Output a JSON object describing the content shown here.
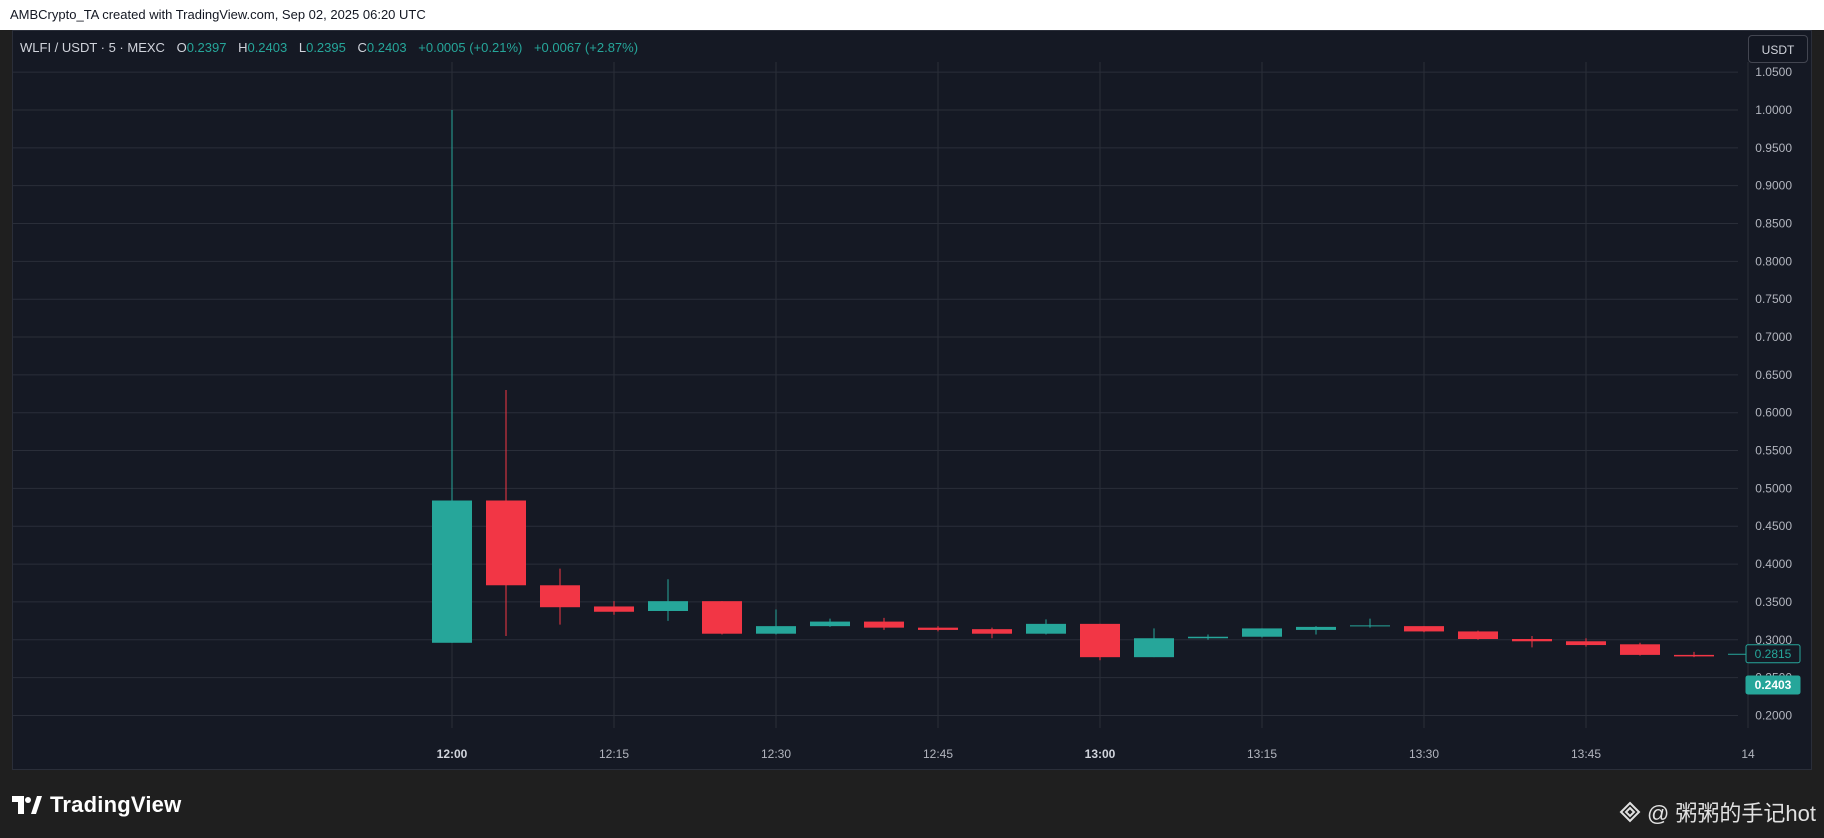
{
  "attribution": "AMBCrypto_TA created with TradingView.com, Sep 02, 2025 06:20 UTC",
  "legend": {
    "symbol": "WLFI / USDT · 5 · MEXC",
    "o_label": "O",
    "o_value": "0.2397",
    "h_label": "H",
    "h_value": "0.2403",
    "l_label": "L",
    "l_value": "0.2395",
    "c_label": "C",
    "c_value": "0.2403",
    "change": "+0.0005 (+0.21%)",
    "change_long": "+0.0067 (+2.87%)"
  },
  "currency_button": "USDT",
  "brand": {
    "name": "TradingView"
  },
  "watermark": {
    "text": "@ 粥粥的手记hot"
  },
  "colors": {
    "up": "#26a69a",
    "down": "#f23645",
    "background": "#151924",
    "grid": "#2a2e39"
  },
  "chart_data": {
    "type": "candlestick",
    "x_tick_labels": [
      "12:00",
      "12:15",
      "12:30",
      "12:45",
      "13:00",
      "13:15",
      "13:30",
      "13:45",
      "14"
    ],
    "y_tick_labels": [
      "0.2000",
      "0.2500",
      "0.3000",
      "0.3500",
      "0.4000",
      "0.4500",
      "0.5000",
      "0.5500",
      "0.6000",
      "0.6500",
      "0.7000",
      "0.7500",
      "0.8000",
      "0.8500",
      "0.9000",
      "0.9500",
      "1.0000",
      "1.0500"
    ],
    "ylim": [
      0.17,
      1.07
    ],
    "grid": true,
    "price_labels": [
      {
        "text": "0.2815",
        "value": 0.2815,
        "style": "outline"
      },
      {
        "text": "0.2403",
        "value": 0.2403,
        "style": "filled"
      }
    ],
    "candles": [
      {
        "time": "12:00",
        "open": 0.296,
        "high": 1.0,
        "low": 0.296,
        "close": 0.484
      },
      {
        "time": "12:05",
        "open": 0.484,
        "high": 0.63,
        "low": 0.305,
        "close": 0.372
      },
      {
        "time": "12:10",
        "open": 0.372,
        "high": 0.394,
        "low": 0.32,
        "close": 0.343
      },
      {
        "time": "12:15",
        "open": 0.344,
        "high": 0.351,
        "low": 0.333,
        "close": 0.337
      },
      {
        "time": "12:20",
        "open": 0.338,
        "high": 0.38,
        "low": 0.325,
        "close": 0.351
      },
      {
        "time": "12:25",
        "open": 0.351,
        "high": 0.351,
        "low": 0.307,
        "close": 0.308
      },
      {
        "time": "12:30",
        "open": 0.308,
        "high": 0.34,
        "low": 0.307,
        "close": 0.318
      },
      {
        "time": "12:35",
        "open": 0.318,
        "high": 0.328,
        "low": 0.317,
        "close": 0.324
      },
      {
        "time": "12:40",
        "open": 0.324,
        "high": 0.329,
        "low": 0.313,
        "close": 0.316
      },
      {
        "time": "12:45",
        "open": 0.316,
        "high": 0.318,
        "low": 0.311,
        "close": 0.313
      },
      {
        "time": "12:50",
        "open": 0.314,
        "high": 0.316,
        "low": 0.302,
        "close": 0.308
      },
      {
        "time": "12:55",
        "open": 0.308,
        "high": 0.327,
        "low": 0.307,
        "close": 0.321
      },
      {
        "time": "13:00",
        "open": 0.321,
        "high": 0.321,
        "low": 0.273,
        "close": 0.277
      },
      {
        "time": "13:05",
        "open": 0.277,
        "high": 0.315,
        "low": 0.277,
        "close": 0.302
      },
      {
        "time": "13:10",
        "open": 0.302,
        "high": 0.307,
        "low": 0.3,
        "close": 0.304
      },
      {
        "time": "13:15",
        "open": 0.304,
        "high": 0.315,
        "low": 0.303,
        "close": 0.315
      },
      {
        "time": "13:20",
        "open": 0.313,
        "high": 0.318,
        "low": 0.307,
        "close": 0.317
      },
      {
        "time": "13:25",
        "open": 0.318,
        "high": 0.328,
        "low": 0.316,
        "close": 0.319
      },
      {
        "time": "13:30",
        "open": 0.318,
        "high": 0.318,
        "low": 0.31,
        "close": 0.311
      },
      {
        "time": "13:35",
        "open": 0.311,
        "high": 0.312,
        "low": 0.3,
        "close": 0.301
      },
      {
        "time": "13:40",
        "open": 0.301,
        "high": 0.305,
        "low": 0.29,
        "close": 0.298
      },
      {
        "time": "13:45",
        "open": 0.298,
        "high": 0.302,
        "low": 0.291,
        "close": 0.293
      },
      {
        "time": "13:50",
        "open": 0.294,
        "high": 0.296,
        "low": 0.279,
        "close": 0.28
      },
      {
        "time": "13:55",
        "open": 0.28,
        "high": 0.284,
        "low": 0.277,
        "close": 0.278
      },
      {
        "time": "14:00",
        "open": 0.281,
        "high": 0.282,
        "low": 0.28,
        "close": 0.2815
      }
    ]
  }
}
